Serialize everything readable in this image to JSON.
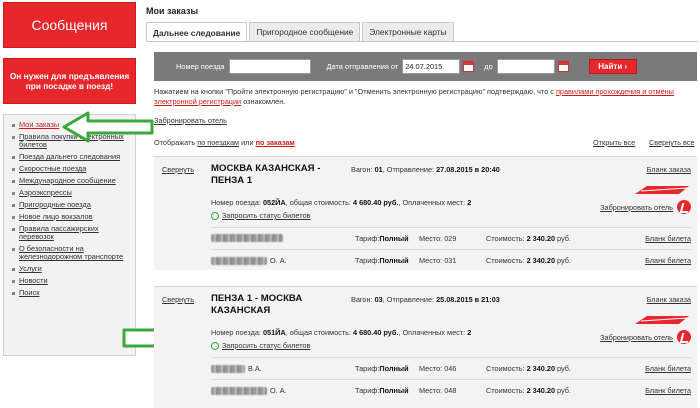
{
  "left": {
    "messages_button": "Сообщения",
    "promo": "Он нужен для предъявления при посадке в поезд!",
    "menu": [
      {
        "label": "Мои заказы",
        "active": true
      },
      {
        "label": "Правила покупки электронных билетов"
      },
      {
        "label": "Поезда дальнего следования"
      },
      {
        "label": "Скоростные поезда"
      },
      {
        "label": "Международное сообщение"
      },
      {
        "label": "Аэроэкспрессы"
      },
      {
        "label": "Пригородные поезда"
      },
      {
        "label": "Новое лицо вокзалов"
      },
      {
        "label": "Правила пассажирских перевозок"
      },
      {
        "label": "О безопасности на железнодорожном транспорте"
      },
      {
        "label": "Услуги"
      },
      {
        "label": "Новости"
      },
      {
        "label": "Поиск"
      }
    ]
  },
  "main": {
    "title": "Мои заказы",
    "tabs": [
      "Дальнее следование",
      "Пригородное сообщение",
      "Электронные карты"
    ],
    "search": {
      "train_label": "Номер поезда",
      "train_value": "",
      "date_label": "Дата отправления от",
      "date_from": "24.07.2015",
      "to_label": "до",
      "date_to": "",
      "find_button": "Найти"
    },
    "info_text": "Нажатием на кнопки \"Пройти электронную регистрацию\" и \"Отменить электронную регистрацию\" подтверждаю, что с",
    "info_link": "правилами прохождения и отмены электронной регистрации",
    "info_tail": "ознакомлен.",
    "book_hotel": "Забронировать отель",
    "filter_prefix": "Отображать",
    "filter_trains": "по поездкам",
    "filter_or": "или",
    "filter_orders": "по заказам",
    "open_all": "Открыть все",
    "close_all": "Свернуть все",
    "orders": [
      {
        "collapse": "Свернуть",
        "route": "МОСКВА КАЗАНСКАЯ - ПЕНЗА 1",
        "wagon_label": "Вагон:",
        "wagon": "01",
        "dep_label": "Отправление:",
        "departure": "27.08.2015 в 20:40",
        "train_label": "Номер поезда:",
        "train": "052ЙА",
        "total_label": "общая стоимость:",
        "total": "4 680.40 руб.",
        "paid_label": "Оплаченных мест:",
        "paid": "2",
        "status_link": "Запросить статус билетов",
        "blank_order": "Бланк заказа",
        "hotel": "Забронировать отель",
        "passengers": [
          {
            "name": "",
            "tariff_label": "Тариф:",
            "tariff": "Полный",
            "seat_label": "Место:",
            "seat": "029",
            "cost_label": "Стоимость:",
            "cost": "2 340.20",
            "rub": "руб.",
            "ticket": "Бланк билета"
          },
          {
            "name": "О. А.",
            "tariff_label": "Тариф:",
            "tariff": "Полный",
            "seat_label": "Место:",
            "seat": "031",
            "cost_label": "Стоимость:",
            "cost": "2 340.20",
            "rub": "руб.",
            "ticket": "Бланк билета"
          }
        ]
      },
      {
        "collapse": "Свернуть",
        "route": "ПЕНЗА 1 - МОСКВА КАЗАНСКАЯ",
        "wagon_label": "Вагон:",
        "wagon": "03",
        "dep_label": "Отправление:",
        "departure": "25.08.2015 в 21:03",
        "train_label": "Номер поезда:",
        "train": "051ЙА",
        "total_label": "общая стоимость:",
        "total": "4 680.40 руб.",
        "paid_label": "Оплаченных мест:",
        "paid": "2",
        "status_link": "Запросить статус билетов",
        "blank_order": "Бланк заказа",
        "hotel": "Забронировать отель",
        "passengers": [
          {
            "name": "В.А.",
            "tariff_label": "Тариф:",
            "tariff": "Полный",
            "seat_label": "Место:",
            "seat": "046",
            "cost_label": "Стоимость:",
            "cost": "2 340.20",
            "rub": "руб.",
            "ticket": "Бланк билета"
          },
          {
            "name": "О. А.",
            "tariff_label": "Тариф:",
            "tariff": "Полный",
            "seat_label": "Место:",
            "seat": "048",
            "cost_label": "Стоимость:",
            "cost": "2 340.20",
            "rub": "руб.",
            "ticket": "Бланк билета"
          }
        ]
      }
    ]
  },
  "colors": {
    "accent": "#e8272c",
    "arrow": "#3aa93a",
    "panel": "#7a7a7a"
  }
}
